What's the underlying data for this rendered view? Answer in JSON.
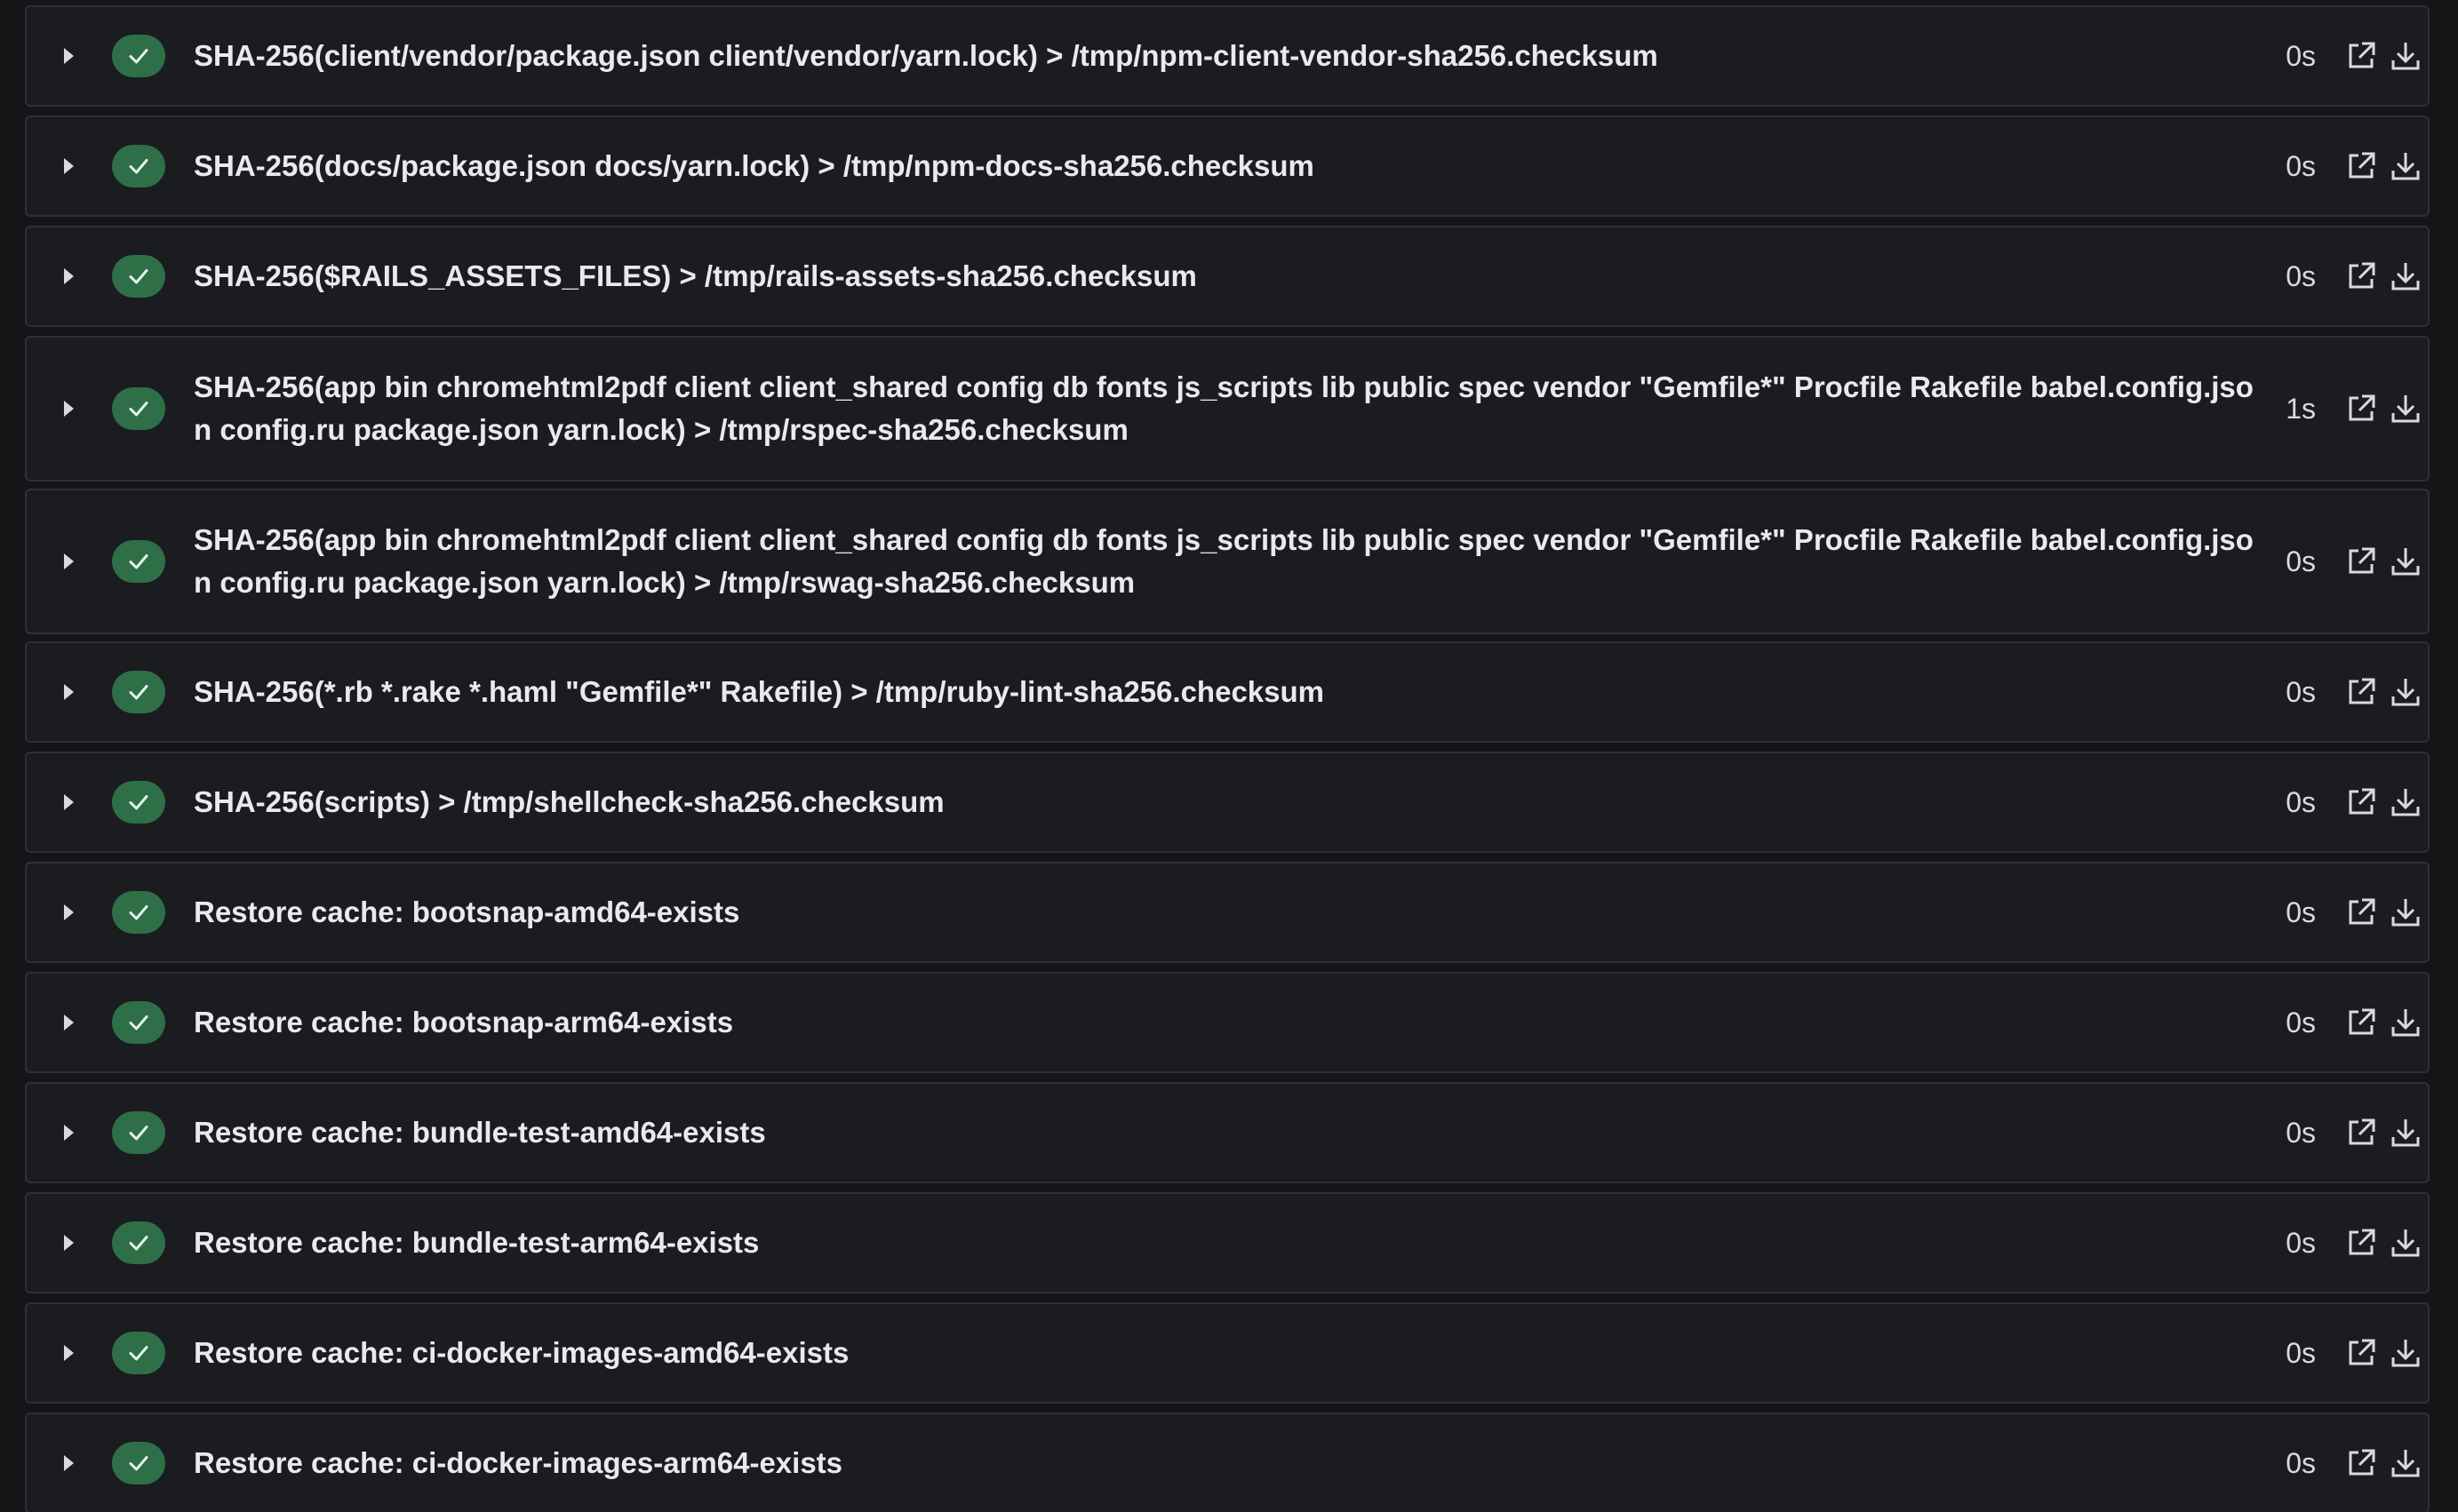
{
  "steps": [
    {
      "title": "SHA-256(client/vendor/package.json client/vendor/yarn.lock) > /tmp/npm-client-vendor-sha256.checksum",
      "duration": "0s",
      "status": "success"
    },
    {
      "title": "SHA-256(docs/package.json docs/yarn.lock) > /tmp/npm-docs-sha256.checksum",
      "duration": "0s",
      "status": "success"
    },
    {
      "title": "SHA-256($RAILS_ASSETS_FILES) > /tmp/rails-assets-sha256.checksum",
      "duration": "0s",
      "status": "success"
    },
    {
      "title": "SHA-256(app bin chromehtml2pdf client client_shared config db fonts js_scripts lib public spec vendor \"Gemfile*\" Procfile Rakefile babel.config.json config.ru package.json yarn.lock) > /tmp/rspec-sha256.checksum",
      "duration": "1s",
      "status": "success"
    },
    {
      "title": "SHA-256(app bin chromehtml2pdf client client_shared config db fonts js_scripts lib public spec vendor \"Gemfile*\" Procfile Rakefile babel.config.json config.ru package.json yarn.lock) > /tmp/rswag-sha256.checksum",
      "duration": "0s",
      "status": "success"
    },
    {
      "title": "SHA-256(*.rb *.rake *.haml \"Gemfile*\" Rakefile) > /tmp/ruby-lint-sha256.checksum",
      "duration": "0s",
      "status": "success"
    },
    {
      "title": "SHA-256(scripts) > /tmp/shellcheck-sha256.checksum",
      "duration": "0s",
      "status": "success"
    },
    {
      "title": "Restore cache: bootsnap-amd64-exists",
      "duration": "0s",
      "status": "success"
    },
    {
      "title": "Restore cache: bootsnap-arm64-exists",
      "duration": "0s",
      "status": "success"
    },
    {
      "title": "Restore cache: bundle-test-amd64-exists",
      "duration": "0s",
      "status": "success"
    },
    {
      "title": "Restore cache: bundle-test-arm64-exists",
      "duration": "0s",
      "status": "success"
    },
    {
      "title": "Restore cache: ci-docker-images-amd64-exists",
      "duration": "0s",
      "status": "success"
    },
    {
      "title": "Restore cache: ci-docker-images-arm64-exists",
      "duration": "0s",
      "status": "success"
    }
  ],
  "icons": {
    "expand": "caret-right-icon",
    "status": "check-circle-icon",
    "open": "external-link-icon",
    "download": "download-icon"
  },
  "colors": {
    "background": "#141517",
    "row_background": "#1b1c1f",
    "row_border": "#2e3035",
    "success": "#2e6f47",
    "text": "#e8eaee"
  }
}
